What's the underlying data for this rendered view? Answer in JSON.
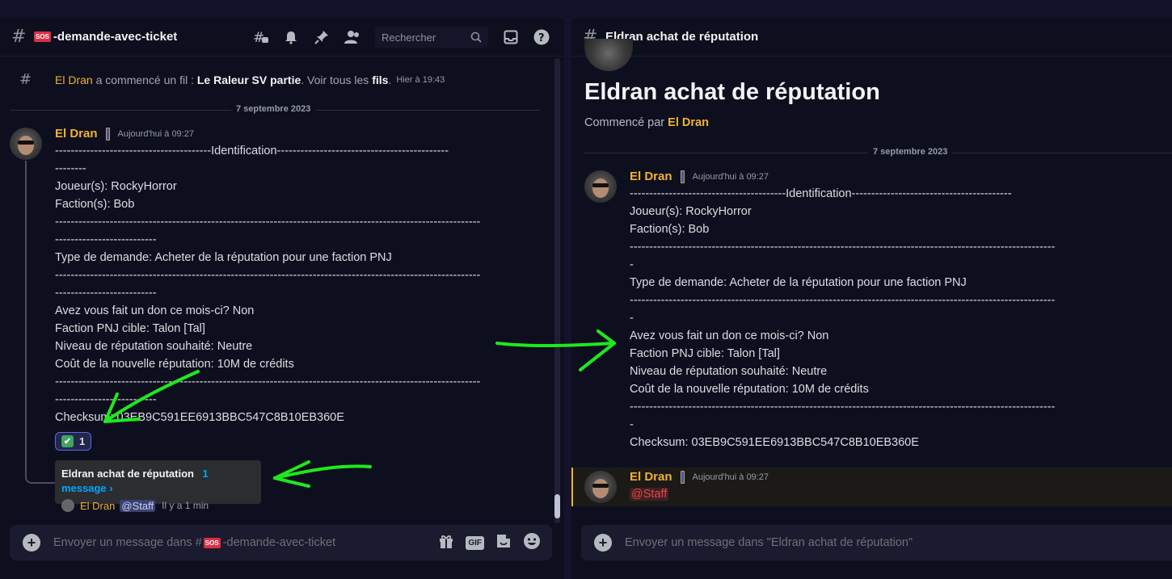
{
  "left": {
    "channel_name": "-demande-avec-ticket",
    "sos_label": "SOS",
    "search_placeholder": "Rechercher",
    "system": {
      "author": "El Dran",
      "action": " a commencé un fil : ",
      "thread_name": "Le Raleur SV partie",
      "see_all": ". Voir tous les ",
      "threads_word": "fils",
      "dot": ".",
      "time": "Hier à 19:43"
    },
    "date_separator": "7 septembre 2023",
    "message": {
      "author": "El Dran",
      "time": "Aujourd'hui à 09:27",
      "lines": [
        "----------------------------------------Identification--------------------------------------------",
        "--------",
        "Joueur(s): RockyHorror",
        "Faction(s): Bob",
        "-------------------------------------------------------------------------------------------------------------",
        "--------------------------",
        "Type de demande: Acheter de la réputation pour une faction PNJ",
        "-------------------------------------------------------------------------------------------------------------",
        "--------------------------",
        "Avez vous fait un don ce mois-ci? Non",
        "Faction PNJ cible: Talon [Tal]",
        "Niveau de réputation souhaité: Neutre",
        "Coût de la nouvelle réputation: 10M de crédits",
        "-------------------------------------------------------------------------------------------------------------",
        "--------------------------",
        "Checksum: 03EB9C591EE6913BBC547C8B10EB360E"
      ],
      "reaction_emoji": "✔",
      "reaction_count": "1"
    },
    "thread": {
      "name": "Eldran achat de réputation",
      "count": "1 message ›",
      "author": "El Dran",
      "mention": "@Staff",
      "ago": "Il y a 1 min"
    },
    "composer": {
      "prefix": "Envoyer un message dans #",
      "channel": "-demande-avec-ticket"
    }
  },
  "right": {
    "thread_title": "Eldran achat de réputation",
    "big_title": "Eldran achat de réputation",
    "started_by_prefix": "Commencé par ",
    "started_by": "El Dran",
    "date_separator": "7 septembre 2023",
    "message": {
      "author": "El Dran",
      "time": "Aujourd'hui à 09:27",
      "lines": [
        "----------------------------------------Identification-----------------------------------------",
        "Joueur(s): RockyHorror",
        "Faction(s): Bob",
        "-------------------------------------------------------------------------------------------------------------",
        "-",
        "Type de demande: Acheter de la réputation pour une faction PNJ",
        "-------------------------------------------------------------------------------------------------------------",
        "-",
        "Avez vous fait un don ce mois-ci? Non",
        "Faction PNJ cible: Talon [Tal]",
        "Niveau de réputation souhaité: Neutre",
        "Coût de la nouvelle réputation: 10M de crédits",
        "-------------------------------------------------------------------------------------------------------------",
        "-",
        "Checksum: 03EB9C591EE6913BBC547C8B10EB360E"
      ]
    },
    "reply": {
      "author": "El Dran",
      "time": "Aujourd'hui à 09:27",
      "mention": "@Staff"
    },
    "composer_placeholder": "Envoyer un message dans \"Eldran achat de réputation\""
  },
  "icons": [
    "threads-icon",
    "bell-icon",
    "pin-icon",
    "members-icon",
    "search-icon",
    "inbox-icon",
    "help-icon",
    "plus-icon",
    "gift-icon",
    "gif-icon",
    "sticker-icon",
    "emoji-icon"
  ],
  "annotation_color": "#1ee81e"
}
